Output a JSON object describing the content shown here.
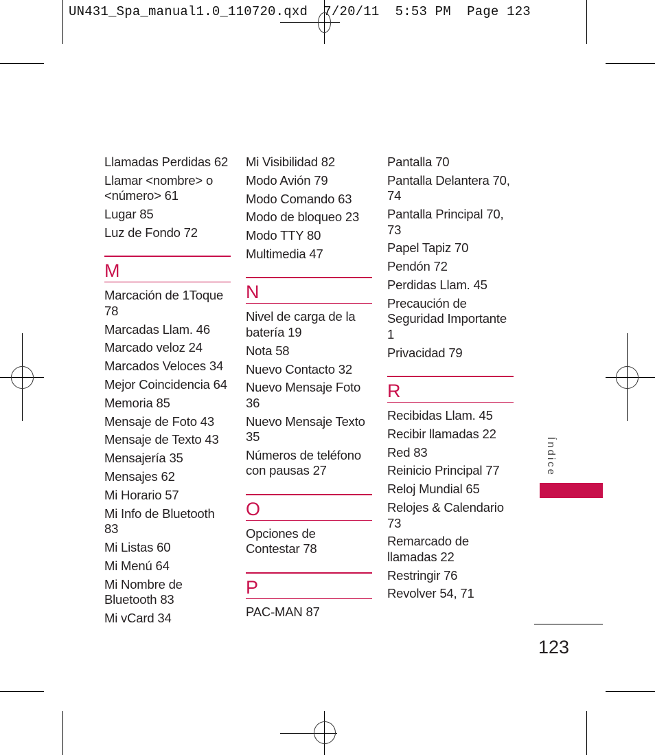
{
  "slug_line": "UN431_Spa_manual1.0_110720.qxd  7/20/11  5:53 PM  Page 123",
  "accent_color": "#c8104b",
  "columns": [
    {
      "lead_entries": [
        "Llamadas Perdidas 62",
        "Llamar <nombre> o <número> 61",
        "Lugar 85",
        "Luz de Fondo 72"
      ],
      "sections": [
        {
          "letter": "M",
          "entries": [
            "Marcación de 1Toque 78",
            "Marcadas Llam. 46",
            "Marcado veloz 24",
            "Marcados Veloces 34",
            "Mejor Coincidencia 64",
            "Memoria 85",
            "Mensaje de Foto 43",
            "Mensaje de Texto 43",
            "Mensajería 35",
            "Mensajes 62",
            "Mi Horario 57",
            "Mi Info de Bluetooth 83",
            "Mi Listas 60",
            "Mi Menú 64",
            "Mi Nombre de Bluetooth 83",
            "Mi vCard 34"
          ]
        }
      ]
    },
    {
      "lead_entries": [
        "Mi Visibilidad 82",
        "Modo Avión 79",
        "Modo Comando 63",
        "Modo de bloqueo 23",
        "Modo TTY 80",
        "Multimedia 47"
      ],
      "sections": [
        {
          "letter": "N",
          "entries": [
            "Nivel de carga de la batería 19",
            "Nota 58",
            "Nuevo Contacto 32",
            "Nuevo Mensaje Foto 36",
            "Nuevo Mensaje Texto 35",
            "Números de teléfono con pausas 27"
          ]
        },
        {
          "letter": "O",
          "entries": [
            "Opciones de Contestar 78"
          ]
        },
        {
          "letter": "P",
          "entries": [
            "PAC-MAN 87"
          ]
        }
      ]
    },
    {
      "lead_entries": [
        "Pantalla 70",
        "Pantalla Delantera 70, 74",
        "Pantalla Principal 70, 73",
        "Papel Tapiz 70",
        "Pendón 72",
        "Perdidas Llam. 45",
        "Precaución de Seguridad Importante 1",
        "Privacidad 79"
      ],
      "sections": [
        {
          "letter": "R",
          "entries": [
            "Recibidas Llam. 45",
            "Recibir llamadas 22",
            "Red 83",
            "Reinicio Principal 77",
            "Reloj Mundial 65",
            "Relojes & Calendario 73",
            "Remarcado de llamadas 22",
            "Restringir 76",
            "Revolver 54, 71"
          ]
        }
      ]
    }
  ],
  "side_tab": {
    "label": "Índice"
  },
  "page_number": "123"
}
